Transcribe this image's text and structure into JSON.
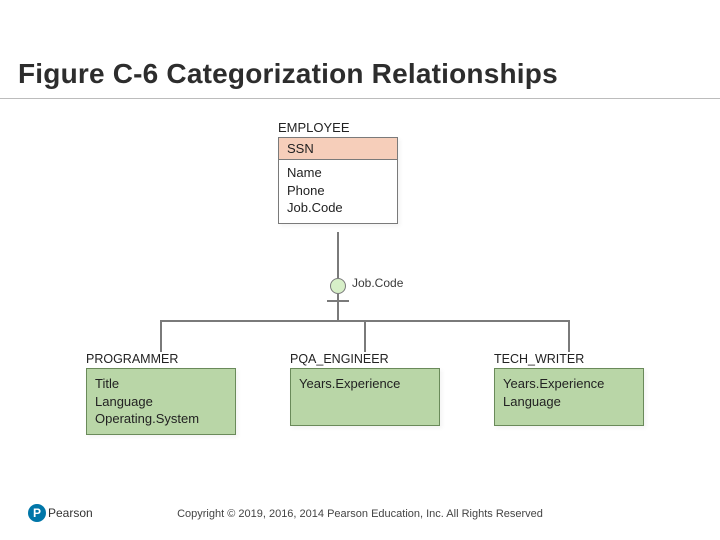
{
  "title": "Figure C-6 Categorization Relationships",
  "discriminator_label": "Job.Code",
  "supertype": {
    "name": "EMPLOYEE",
    "pk": "SSN",
    "attrs": [
      "Name",
      "Phone",
      "Job.Code"
    ]
  },
  "subtypes": [
    {
      "name": "PROGRAMMER",
      "attrs": [
        "Title",
        "Language",
        "Operating.System"
      ]
    },
    {
      "name": "PQA_ENGINEER",
      "attrs": [
        "Years.Experience"
      ]
    },
    {
      "name": "TECH_WRITER",
      "attrs": [
        "Years.Experience",
        "Language"
      ]
    }
  ],
  "footer": {
    "brand": "Pearson",
    "copyright": "Copyright © 2019, 2016, 2014 Pearson Education, Inc. All Rights Reserved"
  }
}
